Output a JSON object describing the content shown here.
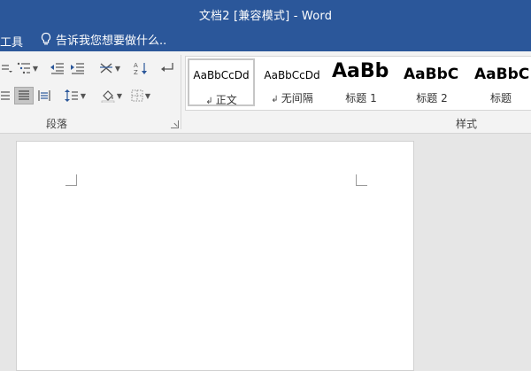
{
  "window": {
    "title": "文档2 [兼容模式] - Word"
  },
  "ribbon_tabs": {
    "tools_partial": "工具"
  },
  "tell_me": {
    "placeholder": "告诉我您想要做什么.."
  },
  "paragraph_group": {
    "label": "段落"
  },
  "styles_group": {
    "label": "样式",
    "items": [
      {
        "preview": "AaBbCcDd",
        "name": "正文",
        "has_para_mark": true,
        "active": true
      },
      {
        "preview": "AaBbCcDd",
        "name": "无间隔",
        "has_para_mark": true,
        "active": false
      },
      {
        "preview": "AaBb",
        "name": "标题 1",
        "has_para_mark": false,
        "active": false
      },
      {
        "preview": "AaBbC",
        "name": "标题 2",
        "has_para_mark": false,
        "active": false
      },
      {
        "preview": "AaBbC",
        "name": "标题",
        "has_para_mark": false,
        "active": false
      }
    ]
  },
  "colors": {
    "title_bar": "#2b579a",
    "ribbon": "#f3f3f3",
    "workspace": "#e6e6e6",
    "page": "#ffffff"
  }
}
